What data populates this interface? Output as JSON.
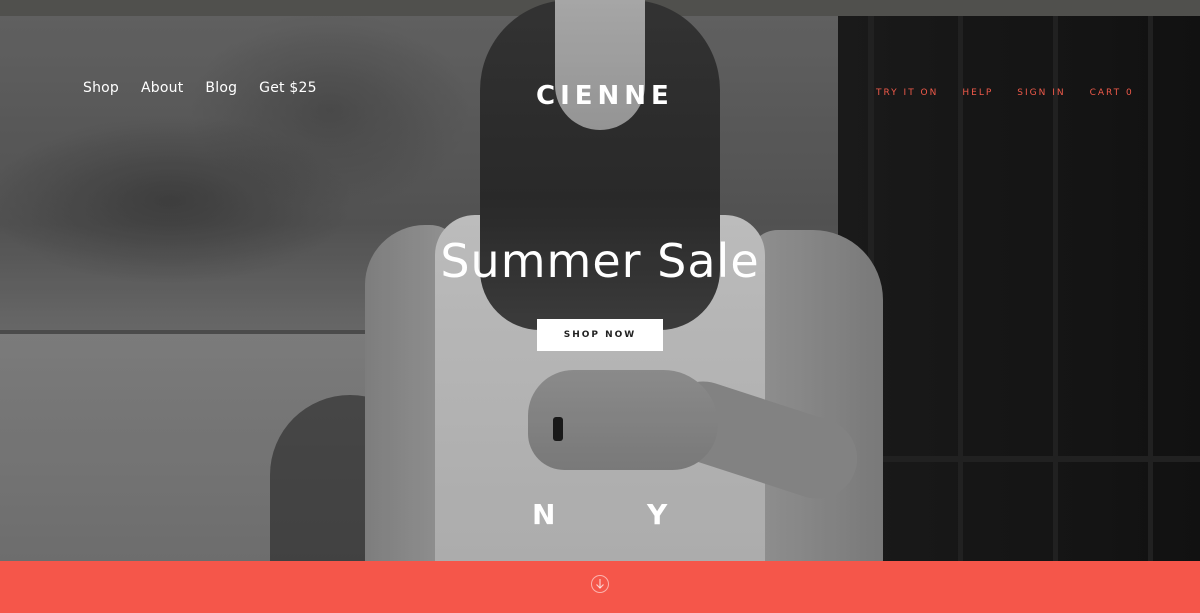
{
  "brand": {
    "logo": "CIENNE",
    "accent_color": "#f5564a",
    "nav_accent_color": "#f05a4a"
  },
  "nav_left": {
    "items": [
      {
        "label": "Shop"
      },
      {
        "label": "About"
      },
      {
        "label": "Blog"
      },
      {
        "label": "Get $25"
      }
    ]
  },
  "nav_right": {
    "items": [
      {
        "label": "TRY IT ON"
      },
      {
        "label": "HELP"
      },
      {
        "label": "SIGN IN"
      },
      {
        "label": "CART 0"
      }
    ]
  },
  "hero": {
    "headline": "Summer Sale",
    "cta_label": "SHOP NOW",
    "ny_left": "N",
    "ny_right": "Y"
  },
  "footer_bar": {
    "icon": "arrow-down-circle-icon"
  }
}
